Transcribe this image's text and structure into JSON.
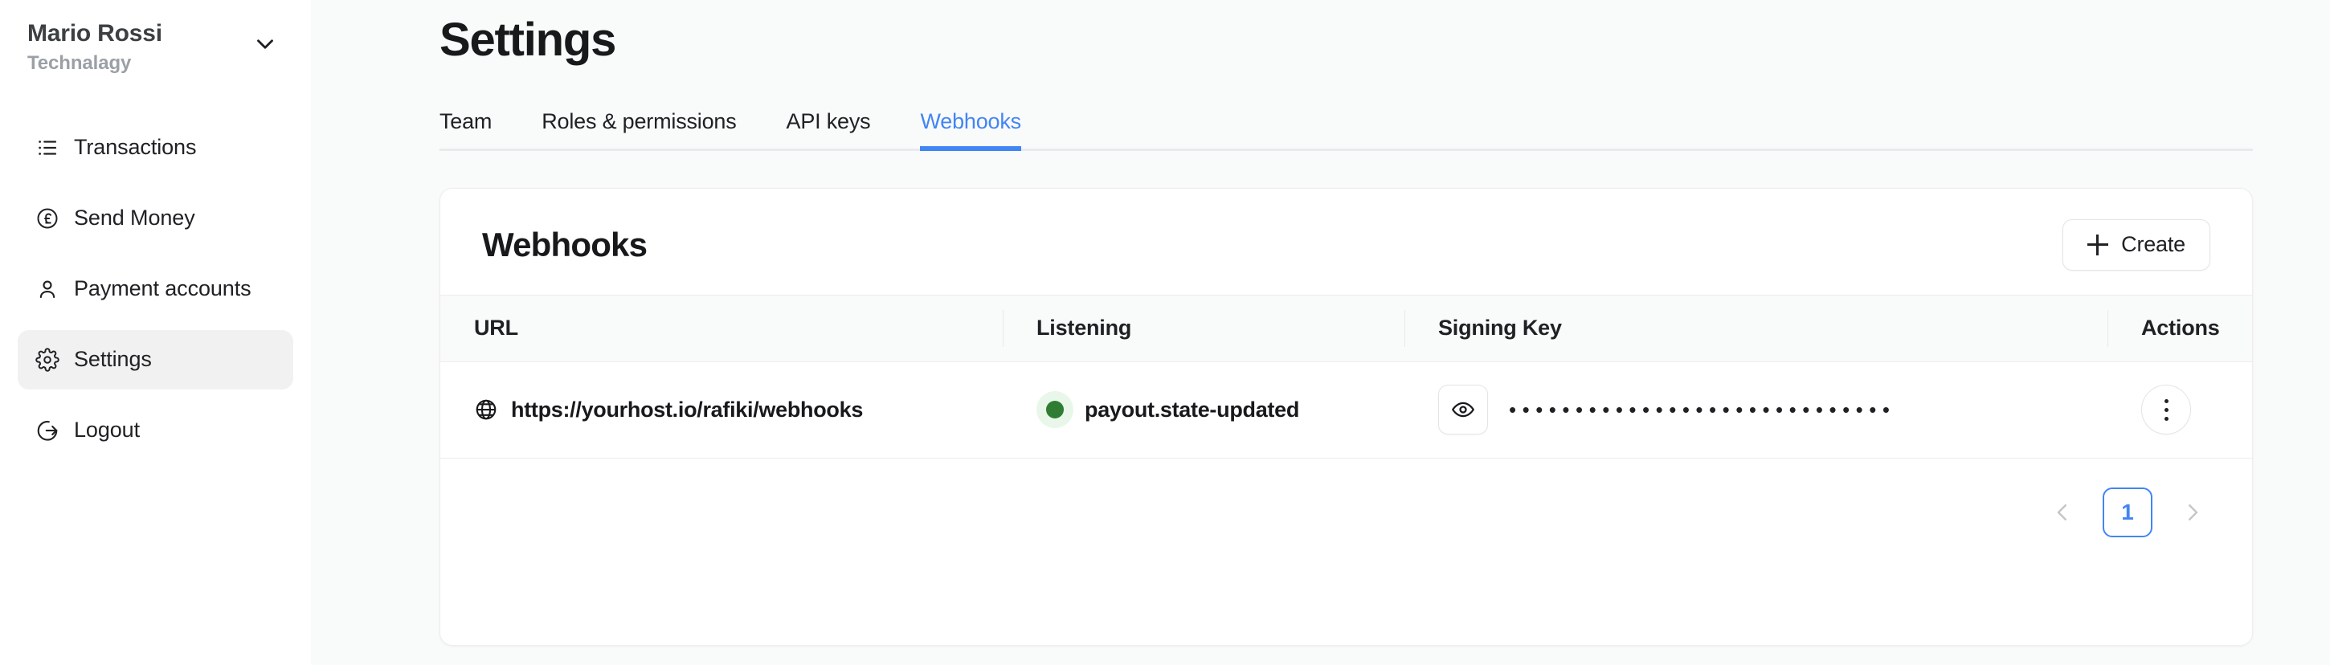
{
  "sidebar": {
    "account": {
      "name": "Mario Rossi",
      "org": "Technalagy",
      "chevron_icon": "chevron-down-icon"
    },
    "items": [
      {
        "label": "Transactions",
        "icon": "list-icon",
        "active": false
      },
      {
        "label": "Send Money",
        "icon": "pound-circle-icon",
        "active": false
      },
      {
        "label": "Payment accounts",
        "icon": "user-icon",
        "active": false
      },
      {
        "label": "Settings",
        "icon": "gear-icon",
        "active": true
      },
      {
        "label": "Logout",
        "icon": "logout-icon",
        "active": false
      }
    ]
  },
  "header": {
    "title": "Settings"
  },
  "tabs": [
    {
      "label": "Team",
      "active": false
    },
    {
      "label": "Roles & permissions",
      "active": false
    },
    {
      "label": "API keys",
      "active": false
    },
    {
      "label": "Webhooks",
      "active": true
    }
  ],
  "card": {
    "title": "Webhooks",
    "create_label": "Create",
    "create_icon": "plus-icon",
    "columns": [
      "URL",
      "Listening",
      "Signing Key",
      "Actions"
    ],
    "rows": [
      {
        "url": "https://yourhost.io/rafiki/webhooks",
        "url_icon": "globe-icon",
        "listening": "payout.state-updated",
        "status_color": "#2e7d32",
        "signing_key_masked": "•••••••••••••••••••••••••••••",
        "reveal_icon": "eye-icon",
        "actions_icon": "kebab-menu-icon"
      }
    ]
  },
  "pagination": {
    "prev_icon": "chevron-left-icon",
    "next_icon": "chevron-right-icon",
    "current_page": "1"
  },
  "colors": {
    "accent": "#4285f4",
    "status_green": "#2e7d32",
    "status_green_bg": "#e9f7ea",
    "page_bg": "#f9fafa",
    "card_bg": "#ffffff",
    "border": "#ededed"
  }
}
